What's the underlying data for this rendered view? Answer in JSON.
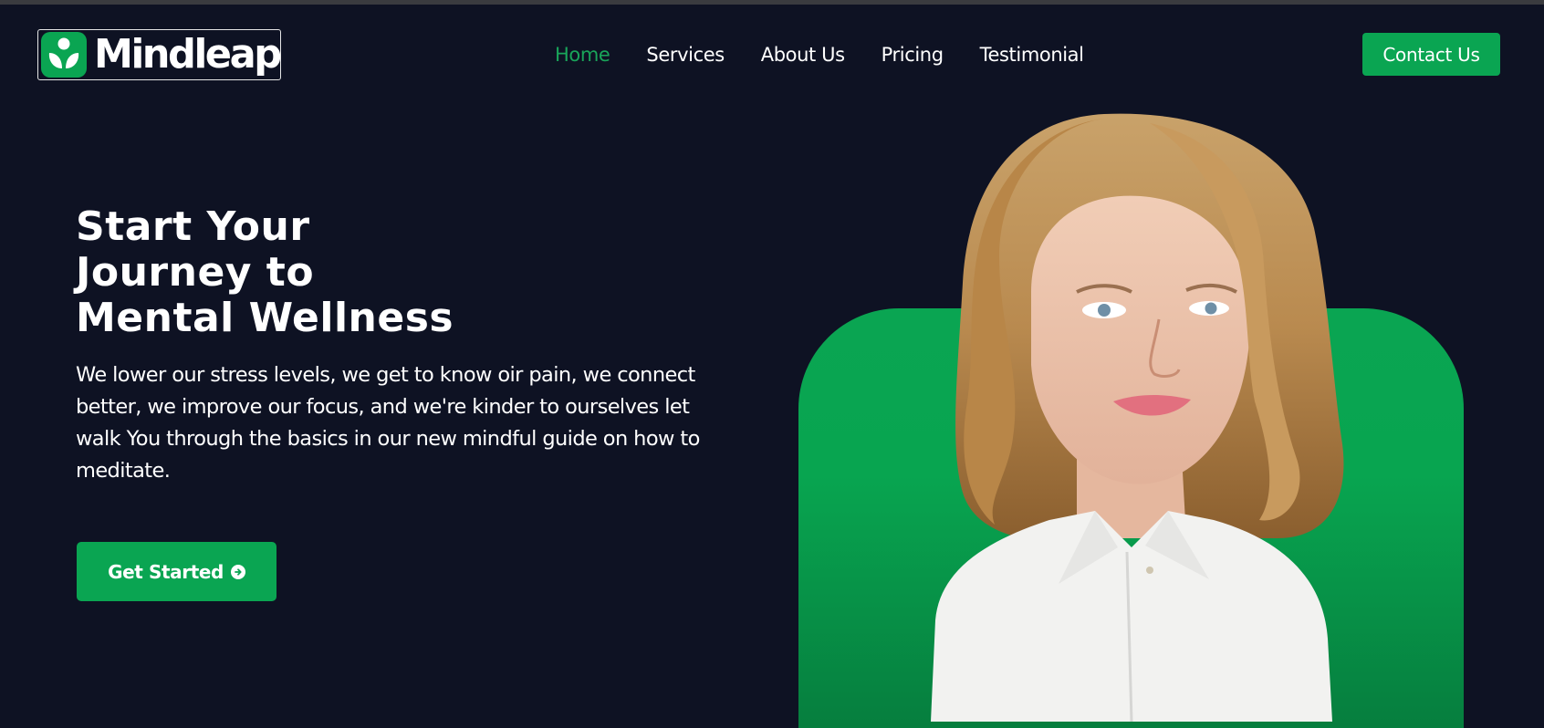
{
  "brand": {
    "name": "Mindleap",
    "accent_color": "#0aa552",
    "icon": "sprout-icon"
  },
  "nav": {
    "items": [
      {
        "label": "Home",
        "active": true
      },
      {
        "label": "Services",
        "active": false
      },
      {
        "label": "About Us",
        "active": false
      },
      {
        "label": "Pricing",
        "active": false
      },
      {
        "label": "Testimonial",
        "active": false
      }
    ],
    "contact_label": "Contact Us"
  },
  "hero": {
    "title_lines": [
      "Start Your",
      "Journey to",
      "Mental Wellness"
    ],
    "description": "We lower our stress levels, we get to know oir pain, we connect better, we improve our focus, and we're kinder to ourselves let walk You through the basics in our new mindful guide on how to meditate.",
    "cta_label": "Get Started",
    "cta_icon": "arrow-right-circle-icon"
  },
  "colors": {
    "background": "#0e1223",
    "accent": "#0aa552",
    "text": "#ffffff"
  }
}
